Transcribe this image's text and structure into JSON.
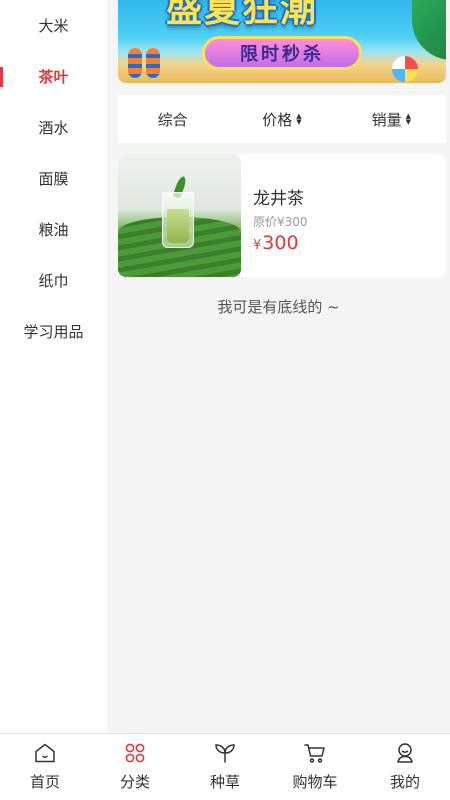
{
  "sidebar": {
    "items": [
      {
        "label": "大米"
      },
      {
        "label": "茶叶",
        "active": true
      },
      {
        "label": "酒水"
      },
      {
        "label": "面膜"
      },
      {
        "label": "粮油"
      },
      {
        "label": "纸巾"
      },
      {
        "label": "学习用品"
      }
    ]
  },
  "banner": {
    "title_art": "盛夏狂潮",
    "subtitle_art": "限时秒杀"
  },
  "sort": {
    "items": [
      {
        "label": "综合"
      },
      {
        "label": "价格"
      },
      {
        "label": "销量"
      }
    ]
  },
  "products": [
    {
      "name": "龙井茶",
      "original_price_label": "原价¥300",
      "currency": "¥",
      "price": "300"
    }
  ],
  "end_note": "我可是有底线的 ~",
  "tabbar": {
    "items": [
      {
        "label": "首页",
        "icon": "home-icon"
      },
      {
        "label": "分类",
        "icon": "category-icon",
        "active": true
      },
      {
        "label": "种草",
        "icon": "sprout-icon"
      },
      {
        "label": "购物车",
        "icon": "cart-icon"
      },
      {
        "label": "我的",
        "icon": "profile-icon"
      }
    ]
  },
  "colors": {
    "accent": "#e4393c",
    "background": "#f5f5f5"
  }
}
